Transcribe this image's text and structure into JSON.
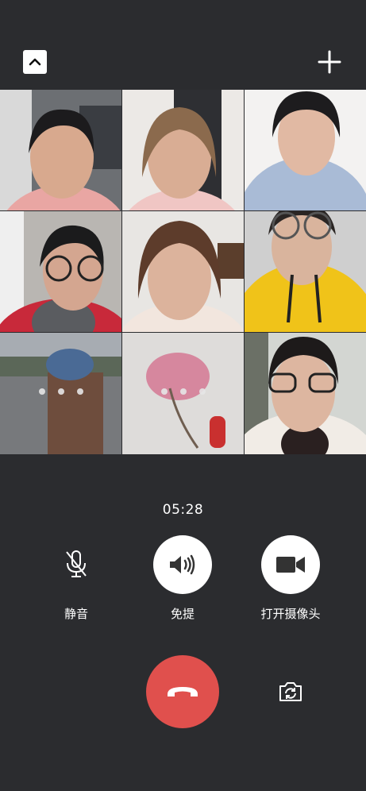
{
  "colors": {
    "background": "#2b2c2f",
    "hangup": "#e0504d",
    "control_circle": "#ffffff"
  },
  "icons": {
    "minimize": "chevron-up-icon",
    "add": "plus-icon",
    "mute": "microphone-icon",
    "speaker": "speaker-icon",
    "camera": "video-camera-icon",
    "hangup": "phone-hangup-icon",
    "switch_camera": "camera-switch-icon"
  },
  "call": {
    "timer": "05:28"
  },
  "participants": [
    {
      "status": "video"
    },
    {
      "status": "video"
    },
    {
      "status": "video"
    },
    {
      "status": "video"
    },
    {
      "status": "video"
    },
    {
      "status": "video"
    },
    {
      "status": "connecting"
    },
    {
      "status": "connecting"
    },
    {
      "status": "video"
    }
  ],
  "controls": {
    "mute_label": "静音",
    "speaker_label": "免提",
    "camera_label": "打开摄像头"
  }
}
